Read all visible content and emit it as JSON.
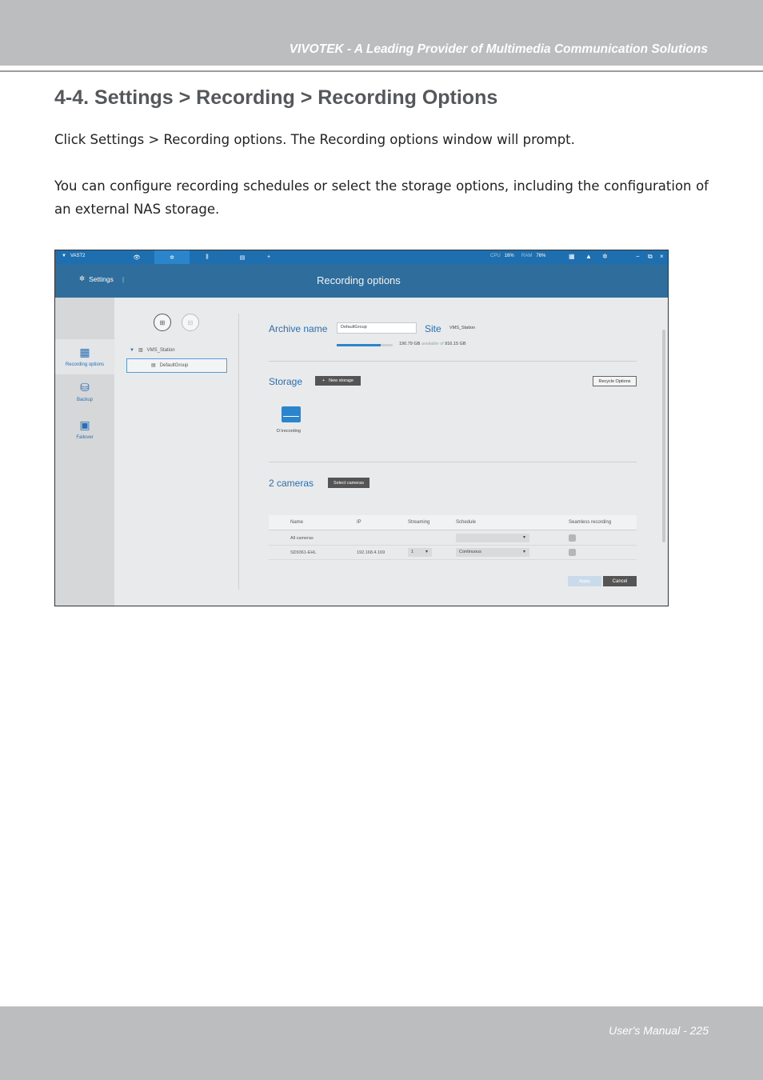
{
  "page": {
    "tagline": "VIVOTEK - A Leading Provider of Multimedia Communication Solutions",
    "section_title": "4-4. Settings > Recording > Recording Options",
    "paragraph1": "Click Settings > Recording options. The Recording options window will prompt.",
    "paragraph2": "You can configure recording schedules or select the storage options, including the configuration of an external NAS storage.",
    "footer": "User's Manual - 225"
  },
  "colors": {
    "band": "#bbbdbf",
    "titlebar": "#1d6fb0",
    "headerbar": "#2f6d9d",
    "accent": "#2a6fb3"
  },
  "app": {
    "app_name": "VAST2",
    "tabs": [
      {
        "icon": "eye-icon",
        "glyph": "👁"
      },
      {
        "icon": "gear-icon",
        "glyph": "✲"
      },
      {
        "icon": "sliders-icon",
        "glyph": "⫼"
      },
      {
        "icon": "export-icon",
        "glyph": "▤"
      },
      {
        "icon": "add-tab-icon",
        "glyph": "+"
      }
    ],
    "cpu_label": "CPU",
    "cpu_value": "16%",
    "ram_label": "RAM",
    "ram_value": "76%",
    "settings_label": "Settings",
    "settings_sep": "|",
    "window_title": "Recording options",
    "nav": [
      {
        "label": "Recording options",
        "icon": "calendar-icon",
        "glyph": "▦"
      },
      {
        "label": "Backup",
        "icon": "backup-icon",
        "glyph": "⛁"
      },
      {
        "label": "Failover",
        "icon": "failover-icon",
        "glyph": "▣"
      }
    ],
    "tree": {
      "station": "VMS_Station",
      "group": "DefaultGroup"
    },
    "archive_label": "Archive name",
    "archive_value": "DefaultGroup",
    "site_label": "Site",
    "site_value": "VMS_Station",
    "space_used": "190.79 GB",
    "space_mid": "available of",
    "space_total": "916.15 GB",
    "space_fill": 0.79,
    "storage_label": "Storage",
    "new_storage": "New storage",
    "recycle_options": "Recycle Options",
    "storage_path": "D:\\recording",
    "cameras_label": "2 cameras",
    "select_cameras": "Select cameras",
    "table": {
      "headers": [
        "Name",
        "IP",
        "Streaming",
        "Schedule",
        "Seamless recording"
      ],
      "rows": [
        {
          "name": "All cameras",
          "ip": "",
          "streaming": "",
          "schedule": ""
        },
        {
          "name": "SD9361-EHL",
          "ip": "192.168.4.169",
          "streaming": "1",
          "schedule": "Continuous"
        }
      ]
    },
    "apply": "Apply",
    "cancel": "Cancel"
  }
}
